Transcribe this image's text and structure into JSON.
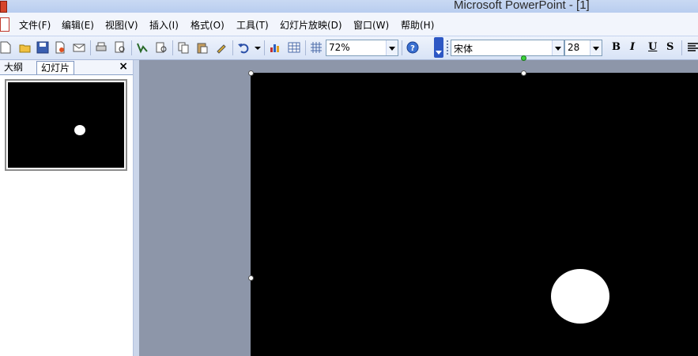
{
  "window": {
    "title": "Microsoft PowerPoint - [1]"
  },
  "menu": {
    "items": [
      "文件(F)",
      "编辑(E)",
      "视图(V)",
      "插入(I)",
      "格式(O)",
      "工具(T)",
      "幻灯片放映(D)",
      "窗口(W)",
      "帮助(H)"
    ]
  },
  "toolbar": {
    "zoom": "72%",
    "font_name": "宋体",
    "font_size": "28",
    "bold": "B",
    "italic": "I",
    "underline": "U",
    "shadow": "S",
    "help_glyph": "?"
  },
  "left_pane": {
    "tab_outline": "大纲",
    "tab_slides": "幻灯片",
    "close": "×"
  },
  "colors": {
    "slide_bg": "#000000",
    "shape_fill": "#ffffff",
    "workspace_bg": "#8d96a9"
  }
}
